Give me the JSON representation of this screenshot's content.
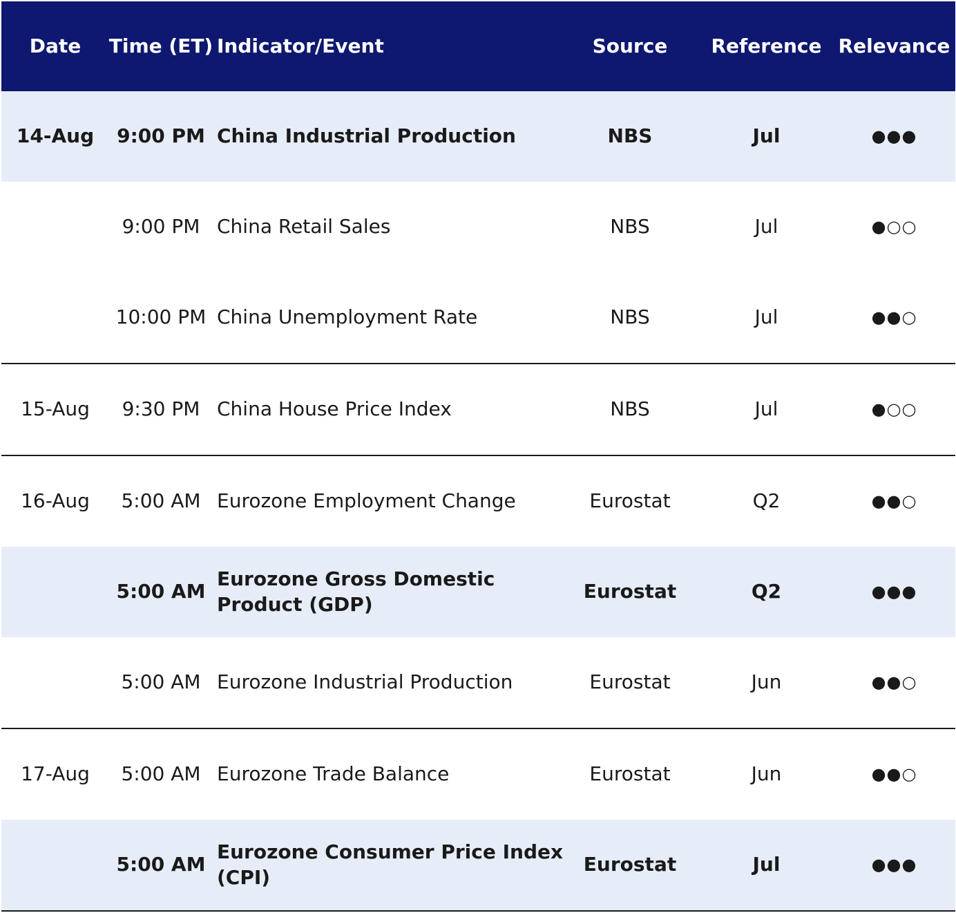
{
  "header": {
    "date": "Date",
    "time": "Time (ET)",
    "event": "Indicator/Event",
    "source": "Source",
    "reference": "Reference",
    "relevance": "Relevance"
  },
  "rows": [
    {
      "date": "14-Aug",
      "time": "9:00 PM",
      "event": "China Industrial Production",
      "source": "NBS",
      "reference": "Jul",
      "relevance": "●●●"
    },
    {
      "date": "",
      "time": "9:00 PM",
      "event": "China Retail Sales",
      "source": "NBS",
      "reference": "Jul",
      "relevance": "●○○"
    },
    {
      "date": "",
      "time": "10:00 PM",
      "event": "China Unemployment Rate",
      "source": "NBS",
      "reference": "Jul",
      "relevance": "●●○"
    },
    {
      "date": "15-Aug",
      "time": "9:30 PM",
      "event": "China House Price Index",
      "source": "NBS",
      "reference": "Jul",
      "relevance": "●○○"
    },
    {
      "date": "16-Aug",
      "time": "5:00 AM",
      "event": "Eurozone Employment Change",
      "source": "Eurostat",
      "reference": "Q2",
      "relevance": "●●○"
    },
    {
      "date": "",
      "time": "5:00 AM",
      "event": "Eurozone Gross Domestic Product (GDP)",
      "source": "Eurostat",
      "reference": "Q2",
      "relevance": "●●●"
    },
    {
      "date": "",
      "time": "5:00 AM",
      "event": "Eurozone Industrial Production",
      "source": "Eurostat",
      "reference": "Jun",
      "relevance": "●●○"
    },
    {
      "date": "17-Aug",
      "time": "5:00 AM",
      "event": "Eurozone Trade Balance",
      "source": "Eurostat",
      "reference": "Jun",
      "relevance": "●●○"
    },
    {
      "date": "",
      "time": "5:00 AM",
      "event": "Eurozone Consumer Price Index (CPI)",
      "source": "Eurostat",
      "reference": "Jul",
      "relevance": "●●●"
    }
  ]
}
